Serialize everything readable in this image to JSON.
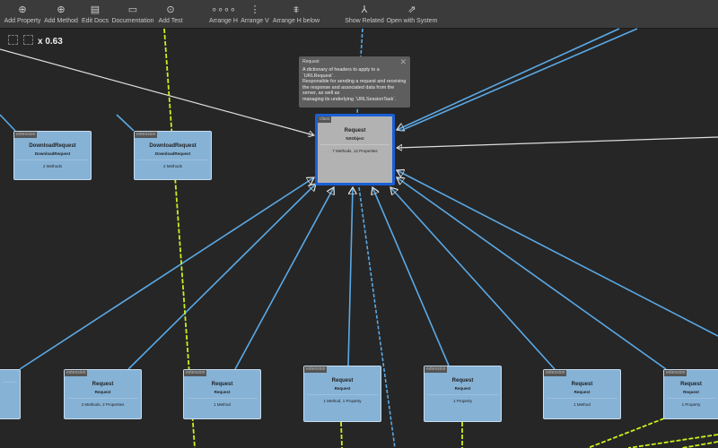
{
  "toolbar": {
    "items": [
      {
        "label": "Add Property",
        "icon": "add-property-icon"
      },
      {
        "label": "Add Method",
        "icon": "add-method-icon"
      },
      {
        "label": "Edit Docs",
        "icon": "edit-docs-icon"
      },
      {
        "label": "Documentation",
        "icon": "documentation-icon"
      },
      {
        "label": "Add Test",
        "icon": "add-test-icon"
      },
      {
        "label": "Arrange H",
        "icon": "arrange-h-icon"
      },
      {
        "label": "Arrange V",
        "icon": "arrange-v-icon"
      },
      {
        "label": "Arrange H below",
        "icon": "arrange-h-below-icon"
      },
      {
        "label": "Show Related",
        "icon": "show-related-icon"
      },
      {
        "label": "Open with System",
        "icon": "open-with-system-icon"
      }
    ]
  },
  "zoom": "x 0.63",
  "tooltip": {
    "title": "Request",
    "body": "A dictionary of headers to apply to a `URLRequest`.\nResponsible for sending a request and receiving the response and associated data from the server, as well as\nmanaging its underlying `URLSessionTask`."
  },
  "center": {
    "tag": "class",
    "title": "Request",
    "subtitle": "NSObject",
    "counts": "7 Methods, 12 Properties"
  },
  "nodes": [
    {
      "tag": "extension",
      "title": "DownloadRequest",
      "subtitle": "DownloadRequest",
      "counts": "2 Methods"
    },
    {
      "tag": "extension",
      "title": "DownloadRequest",
      "subtitle": "DownloadRequest",
      "counts": "2 Methods"
    },
    {
      "tag": "",
      "title": "",
      "subtitle": "",
      "counts": ""
    },
    {
      "tag": "extension",
      "title": "Request",
      "subtitle": "Request",
      "counts": "2 Methods, 2 Properties"
    },
    {
      "tag": "extension",
      "title": "Request",
      "subtitle": "Request",
      "counts": "1 Method"
    },
    {
      "tag": "extension",
      "title": "Request",
      "subtitle": "Request",
      "counts": "1 Method, 1 Property"
    },
    {
      "tag": "extension",
      "title": "Request",
      "subtitle": "Request",
      "counts": "1 Property"
    },
    {
      "tag": "extension",
      "title": "Request",
      "subtitle": "Request",
      "counts": "1 Method"
    },
    {
      "tag": "extension",
      "title": "Request",
      "subtitle": "Request",
      "counts": "1 Property"
    }
  ],
  "colors": {
    "accent": "#1a5fd6",
    "node": "#86b2d6",
    "edge": "#5aa9e6",
    "dependency": "#c8f01e"
  }
}
